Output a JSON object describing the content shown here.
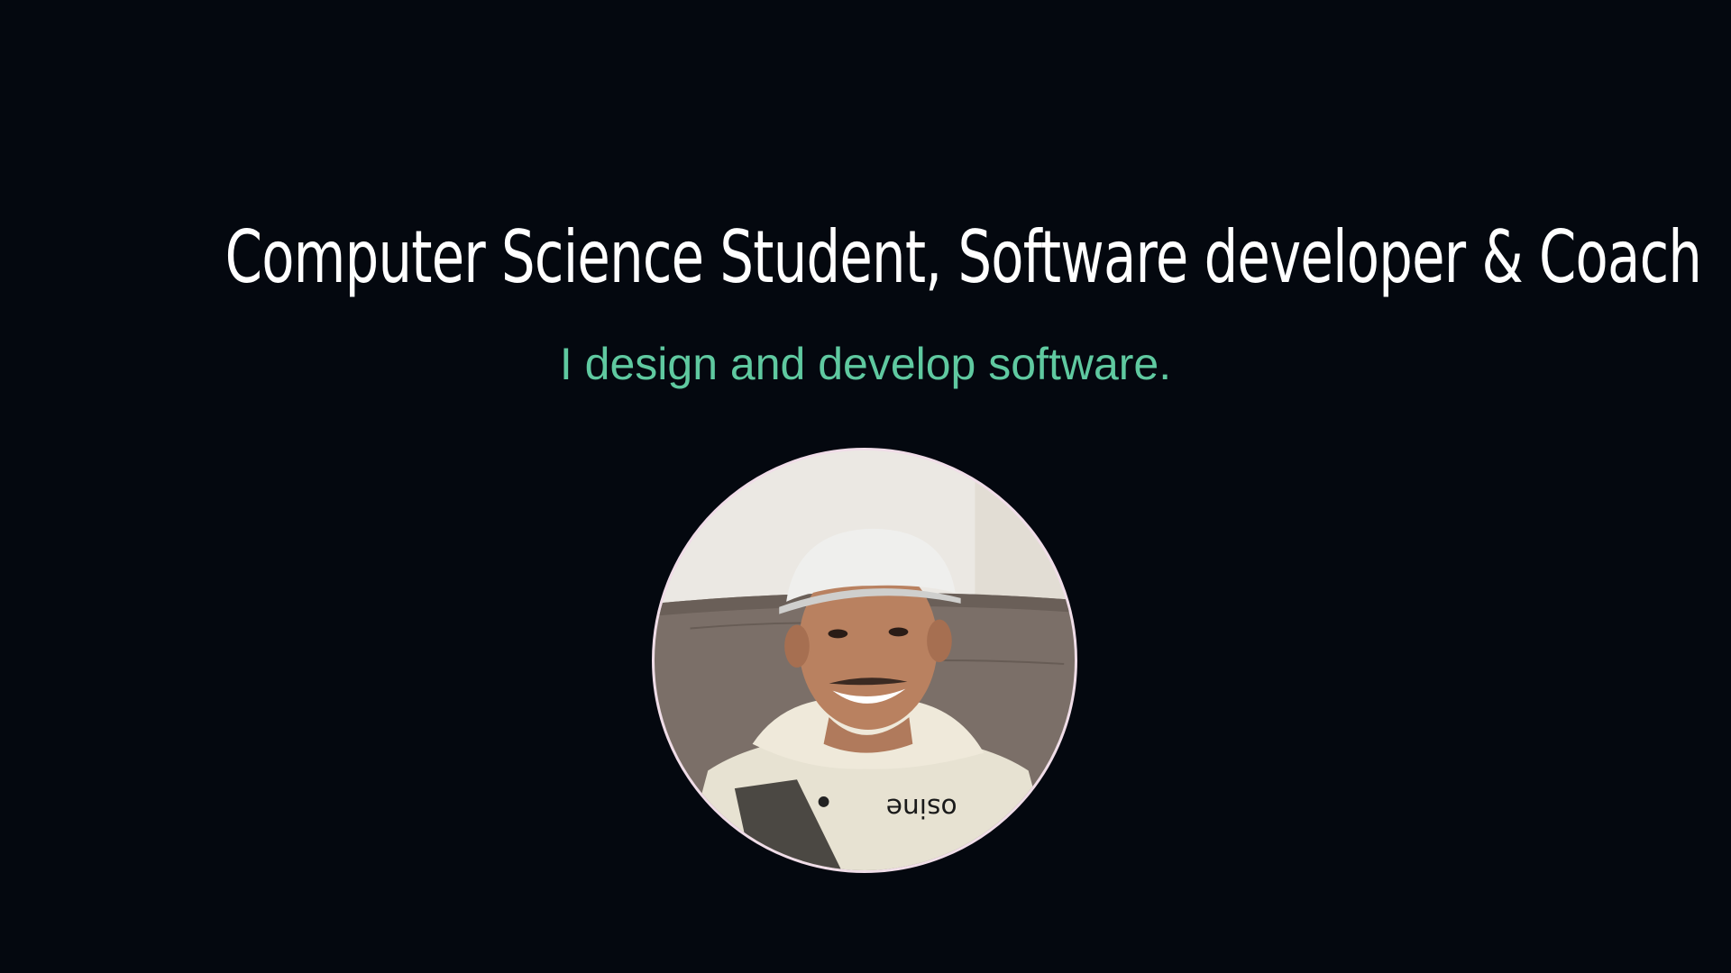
{
  "hero": {
    "headline": "Computer Science Student, Software developer & Coach",
    "tagline": "I design and develop software."
  },
  "avatar": {
    "hoodie_text": "osine"
  },
  "colors": {
    "background": "#04080f",
    "headline": "#ffffff",
    "tagline": "#5fc9a0",
    "avatar_border": "#f0dde8"
  }
}
